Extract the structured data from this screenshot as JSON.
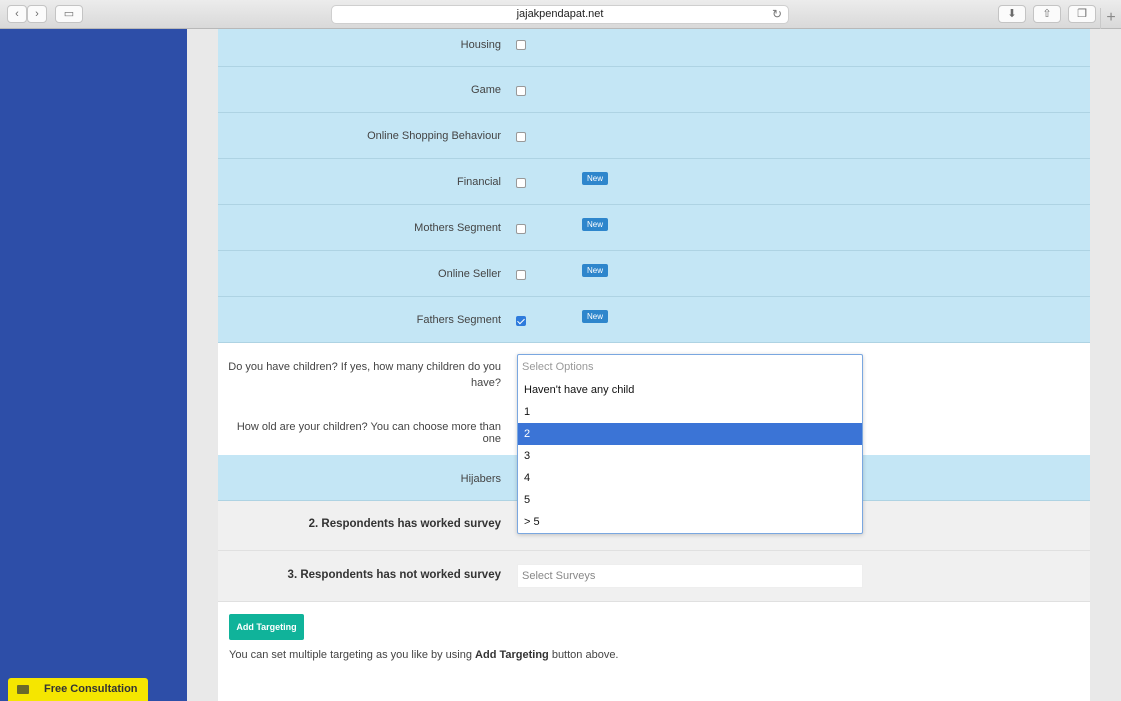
{
  "browser": {
    "url": "jajakpendapat.net",
    "back_icon": "chevron-left-icon",
    "forward_icon": "chevron-right-icon"
  },
  "segments": [
    {
      "label": "Housing",
      "checked": false,
      "badge": ""
    },
    {
      "label": "Game",
      "checked": false,
      "badge": ""
    },
    {
      "label": "Online Shopping Behaviour",
      "checked": false,
      "badge": ""
    },
    {
      "label": "Financial",
      "checked": false,
      "badge": "New"
    },
    {
      "label": "Mothers Segment",
      "checked": false,
      "badge": "New"
    },
    {
      "label": "Online Seller",
      "checked": false,
      "badge": "New"
    },
    {
      "label": "Fathers Segment",
      "checked": true,
      "badge": "New"
    }
  ],
  "questions": {
    "children_count": "Do you have children? If yes, how many children do you have?",
    "children_age": "How old are your children? You can choose more than one"
  },
  "dropdown": {
    "placeholder": "Select Options",
    "options": [
      "Haven't have any child",
      "1",
      "2",
      "3",
      "4",
      "5",
      "> 5"
    ],
    "selected": "2"
  },
  "hijabers": {
    "label": "Hijabers"
  },
  "worked_survey": {
    "label": "2. Respondents has worked survey"
  },
  "not_worked_survey": {
    "label": "3. Respondents has not worked survey",
    "placeholder": "Select Surveys"
  },
  "actions": {
    "add_targeting": "Add Targeting",
    "note_before": "You can set multiple targeting as you like by using ",
    "note_bold": "Add Targeting",
    "note_after": " button above."
  },
  "consultation": {
    "label": "Free Consultation"
  }
}
